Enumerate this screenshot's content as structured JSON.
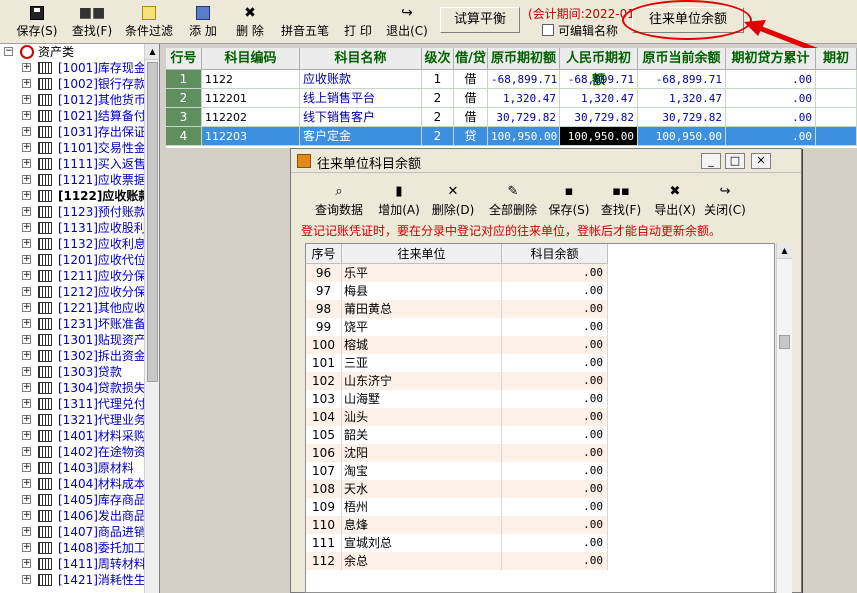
{
  "toolbar": {
    "buttons": [
      {
        "label": "保存(S)",
        "icon": "save-icon"
      },
      {
        "label": "查找(F)",
        "icon": "binoculars-icon"
      },
      {
        "label": "条件过滤",
        "icon": "filter-icon"
      },
      {
        "label": "添 加",
        "icon": "add-icon"
      },
      {
        "label": "删 除",
        "icon": "delete-icon"
      },
      {
        "label": "拼音五笔",
        "icon": "none"
      },
      {
        "label": "打 印",
        "icon": "none"
      },
      {
        "label": "退出(C)",
        "icon": "exit-icon"
      }
    ],
    "trial_balance_label": "试算平衡",
    "period_text": "(会计期间:2022-01)",
    "editable_name_label": "可编辑名称",
    "contact_balance_label": "往来单位余额"
  },
  "sidebar": {
    "root_label": "资产类",
    "items": [
      "[1001]库存现金",
      "[1002]银行存款",
      "[1012]其他货币",
      "[1021]结算备付",
      "[1031]存出保证",
      "[1101]交易性金",
      "[1111]买入返售",
      "[1121]应收票据",
      "[1122]应收账款",
      "[1123]预付账款",
      "[1131]应收股利",
      "[1132]应收利息",
      "[1201]应收代位",
      "[1211]应收分保",
      "[1212]应收分保",
      "[1221]其他应收",
      "[1231]坏账准备",
      "[1301]贴现资产",
      "[1302]拆出资金",
      "[1303]贷款",
      "[1304]贷款损失",
      "[1311]代理兑付",
      "[1321]代理业务",
      "[1401]材料采购",
      "[1402]在途物资",
      "[1403]原材料",
      "[1404]材料成本",
      "[1405]库存商品",
      "[1406]发出商品",
      "[1407]商品进销",
      "[1408]委托加工",
      "[1411]周转材料",
      "[1421]消耗性生"
    ],
    "bold_index": 8
  },
  "grid": {
    "headers": [
      "行号",
      "科目编码",
      "科目名称",
      "级次",
      "借/贷",
      "原币期初额",
      "人民币期初额",
      "原币当前余额",
      "期初贷方累计",
      "期初"
    ],
    "rows": [
      {
        "no": "1",
        "code": "1122",
        "name": "应收账款",
        "level": "1",
        "dc": "借",
        "orig_open": "-68,899.71",
        "rmb_open": "-68,899.71",
        "orig_cur": "-68,899.71",
        "credit": ".00"
      },
      {
        "no": "2",
        "code": "112201",
        "name": "线上销售平台",
        "level": "2",
        "dc": "借",
        "orig_open": "1,320.47",
        "rmb_open": "1,320.47",
        "orig_cur": "1,320.47",
        "credit": ".00"
      },
      {
        "no": "3",
        "code": "112202",
        "name": "线下销售客户",
        "level": "2",
        "dc": "借",
        "orig_open": "30,729.82",
        "rmb_open": "30,729.82",
        "orig_cur": "30,729.82",
        "credit": ".00"
      },
      {
        "no": "4",
        "code": "112203",
        "name": "客户定金",
        "level": "2",
        "dc": "贷",
        "orig_open": "100,950.00",
        "rmb_open": "100,950.00",
        "orig_cur": "100,950.00",
        "credit": ".00"
      }
    ]
  },
  "dialog": {
    "title": "往来单位科目余额",
    "buttons": [
      {
        "label": "查询数据",
        "icon": "query-icon"
      },
      {
        "label": "增加(A)",
        "icon": "add-icon"
      },
      {
        "label": "删除(D)",
        "icon": "delete-icon"
      },
      {
        "label": "全部删除",
        "icon": "eraser-icon"
      },
      {
        "label": "保存(S)",
        "icon": "save-icon"
      },
      {
        "label": "查找(F)",
        "icon": "binoculars-icon"
      },
      {
        "label": "导出(X)",
        "icon": "export-icon"
      },
      {
        "label": "关闭(C)",
        "icon": "exit-icon"
      }
    ],
    "notice": "登记记账凭证时，要在分录中登记对应的往来单位，登帐后才能自动更新余额。",
    "headers": [
      "序号",
      "往来单位",
      "科目余额"
    ],
    "rows": [
      {
        "no": "96",
        "name": "乐平",
        "balance": ".00"
      },
      {
        "no": "97",
        "name": "梅县",
        "balance": ".00"
      },
      {
        "no": "98",
        "name": "莆田黄总",
        "balance": ".00"
      },
      {
        "no": "99",
        "name": "饶平",
        "balance": ".00"
      },
      {
        "no": "100",
        "name": "榕城",
        "balance": ".00"
      },
      {
        "no": "101",
        "name": "三亚",
        "balance": ".00"
      },
      {
        "no": "102",
        "name": "山东济宁",
        "balance": ".00"
      },
      {
        "no": "103",
        "name": "山海墅",
        "balance": ".00"
      },
      {
        "no": "104",
        "name": "汕头",
        "balance": ".00"
      },
      {
        "no": "105",
        "name": "韶关",
        "balance": ".00"
      },
      {
        "no": "106",
        "name": "沈阳",
        "balance": ".00"
      },
      {
        "no": "107",
        "name": "淘宝",
        "balance": ".00"
      },
      {
        "no": "108",
        "name": "天水",
        "balance": ".00"
      },
      {
        "no": "109",
        "name": "梧州",
        "balance": ".00"
      },
      {
        "no": "110",
        "name": "息烽",
        "balance": ".00"
      },
      {
        "no": "111",
        "name": "宣城刘总",
        "balance": ".00"
      },
      {
        "no": "112",
        "name": "余总",
        "balance": ".00"
      }
    ]
  },
  "colors": {
    "highlight": "#e00000",
    "selected_row": "#3d8fe0",
    "row_number_bg": "#5f8f5f",
    "header_text": "#006000",
    "tree_link": "#0000c0"
  }
}
